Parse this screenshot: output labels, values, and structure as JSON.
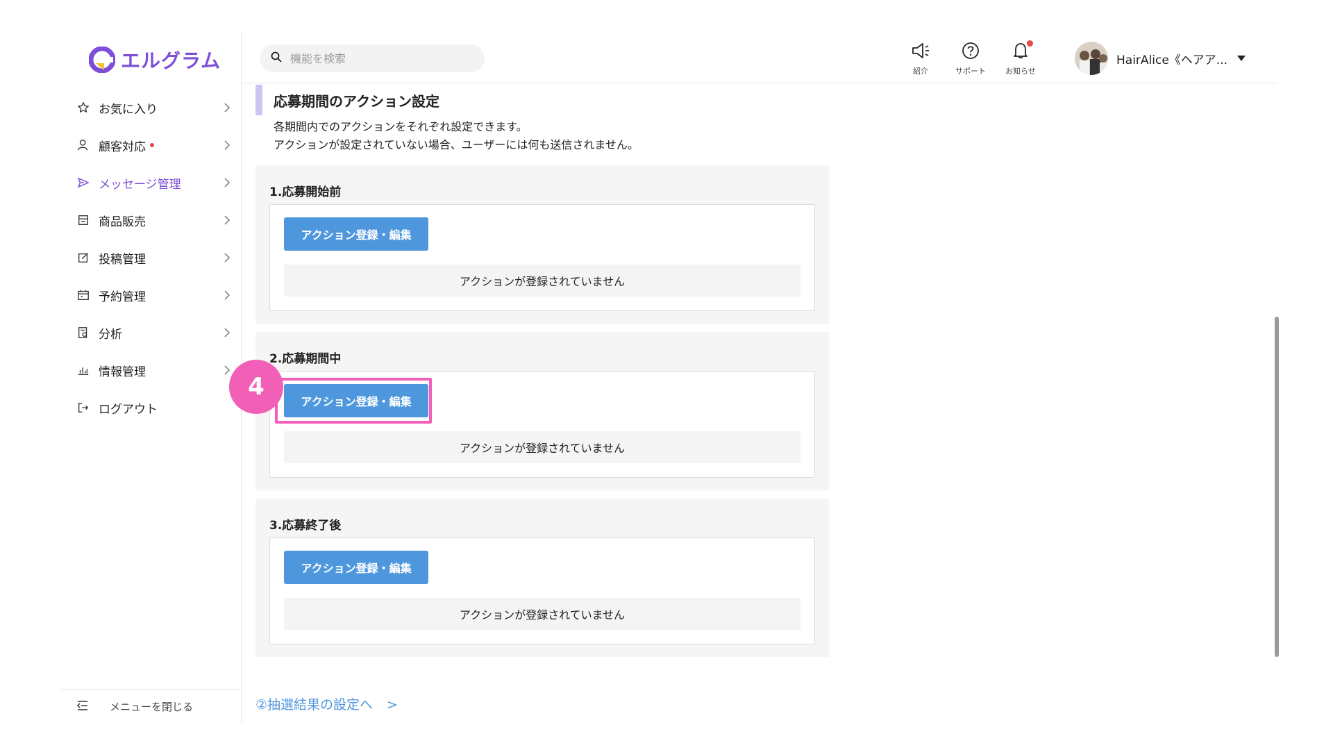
{
  "app": {
    "logo_text": "エルグラム"
  },
  "sidebar": {
    "items": [
      {
        "label": "お気に入り",
        "icon": "star-icon"
      },
      {
        "label": "顧客対応",
        "icon": "user-icon",
        "dot": true
      },
      {
        "label": "メッセージ管理",
        "icon": "send-icon",
        "active": true
      },
      {
        "label": "商品販売",
        "icon": "store-icon"
      },
      {
        "label": "投稿管理",
        "icon": "edit-icon"
      },
      {
        "label": "予約管理",
        "icon": "calendar-icon"
      },
      {
        "label": "分析",
        "icon": "report-icon"
      },
      {
        "label": "情報管理",
        "icon": "chart-icon"
      },
      {
        "label": "ログアウト",
        "icon": "logout-icon"
      }
    ],
    "footer_label": "メニューを閉じる"
  },
  "header": {
    "search_placeholder": "機能を検索",
    "icons": {
      "intro": "紹介",
      "support": "サポート",
      "news": "お知らせ"
    },
    "user_name": "HairAlice《ヘアア..."
  },
  "section": {
    "title": "応募期間のアクション設定",
    "desc_line1": "各期間内でのアクションをそれぞれ設定できます。",
    "desc_line2": "アクションが設定されていない場合、ユーザーには何も送信されません。"
  },
  "periods": [
    {
      "title": "1.応募開始前",
      "button": "アクション登録・編集",
      "empty": "アクションが登録されていません"
    },
    {
      "title": "2.応募期間中",
      "button": "アクション登録・編集",
      "empty": "アクションが登録されていません"
    },
    {
      "title": "3.応募終了後",
      "button": "アクション登録・編集",
      "empty": "アクションが登録されていません"
    }
  ],
  "step_badge": "4",
  "next_link": {
    "label": "②抽選結果の設定へ",
    "arrow": ">"
  },
  "colors": {
    "accent": "#7d4fd8",
    "button": "#4f97dd",
    "highlight": "#f35fb8",
    "notify": "#e84848"
  }
}
